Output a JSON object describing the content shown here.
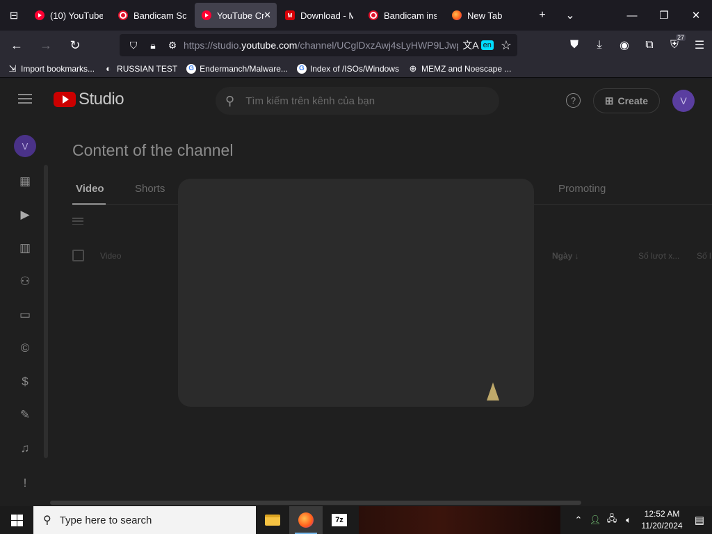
{
  "browser": {
    "tabs": [
      {
        "label": "(10) YouTube",
        "icon": "youtube-icon"
      },
      {
        "label": "Bandicam Scre",
        "icon": "bandicam-icon"
      },
      {
        "label": "YouTube Cr",
        "icon": "youtube-icon",
        "active": true
      },
      {
        "label": "Download - M",
        "icon": "mega-icon"
      },
      {
        "label": "Bandicam inst",
        "icon": "bandicam-icon"
      },
      {
        "label": "New Tab",
        "icon": "firefox-icon"
      }
    ],
    "url": {
      "prefix": "https://studio.",
      "host": "youtube.com",
      "path": "/channel/UCglDxzAwj4sLyHWP9LJwpV"
    },
    "translate_lang": "en",
    "extension_badge": "27",
    "bookmarks": [
      {
        "label": "Import bookmarks...",
        "icon": "import-icon"
      },
      {
        "label": "RUSSIAN TEST",
        "icon": "github-icon"
      },
      {
        "label": "Endermanch/Malware...",
        "icon": "google-icon"
      },
      {
        "label": "Index of /ISOs/Windows",
        "icon": "google-icon"
      },
      {
        "label": "MEMZ and Noescape ...",
        "icon": "globe-icon"
      }
    ]
  },
  "studio": {
    "brand": "Studio",
    "search_placeholder": "Tìm kiếm trên kênh của bạn",
    "help_glyph": "?",
    "create_label": "Create",
    "avatar_letter": "V",
    "page_title": "Content of the channel",
    "tabs": [
      "Video",
      "Shorts",
      "Promoting"
    ],
    "table_headers": {
      "video": "Video",
      "date": "Ngày ↓",
      "views": "Số lượt x...",
      "extra": "Số l"
    },
    "sidebar_icons": [
      "dashboard-icon",
      "content-icon",
      "analytics-icon",
      "community-icon",
      "subtitles-icon",
      "copyright-icon",
      "earn-icon",
      "customization-icon",
      "audio-library-icon",
      "feedback-icon"
    ]
  },
  "taskbar": {
    "search_placeholder": "Type here to search",
    "sevenzip_label": "7z",
    "time": "12:52 AM",
    "date": "11/20/2024"
  }
}
